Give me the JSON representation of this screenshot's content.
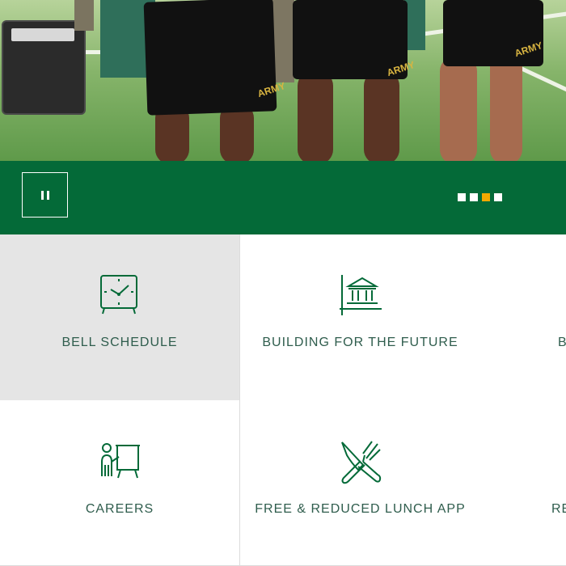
{
  "hero": {
    "image_description": "",
    "short_text": "ARMY",
    "accent_colors": {
      "turf": "#86b46a",
      "shorts": "#111111",
      "logo_gold": "#d8b441"
    }
  },
  "controls": {
    "pause_icon": "pause-icon",
    "pause_label": "Pause",
    "slides": [
      {
        "label": "Slide 1",
        "active": false
      },
      {
        "label": "Slide 2",
        "active": false
      },
      {
        "label": "Slide 3",
        "active": true
      },
      {
        "label": "Slide 4",
        "active": false
      }
    ],
    "colors": {
      "bar": "#046a38",
      "dot": "#ffffff",
      "dot_active": "#f2a900"
    }
  },
  "tiles": [
    {
      "label": "BELL SCHEDULE",
      "icon": "clock-icon",
      "active": true
    },
    {
      "label": "BUILDING FOR THE FUTURE",
      "icon": "building-icon",
      "active": false
    },
    {
      "label": "B",
      "icon": "",
      "active": false
    },
    {
      "label": "CAREERS",
      "icon": "presentation-icon",
      "active": false
    },
    {
      "label": "FREE & REDUCED LUNCH APP",
      "icon": "utensils-icon",
      "active": false
    },
    {
      "label": "RE",
      "icon": "",
      "active": false
    }
  ],
  "colors": {
    "tile_text": "#2f5d4d",
    "icon_stroke": "#046a38",
    "tile_active_bg": "#e5e5e5",
    "divider": "#dcdcdc"
  }
}
